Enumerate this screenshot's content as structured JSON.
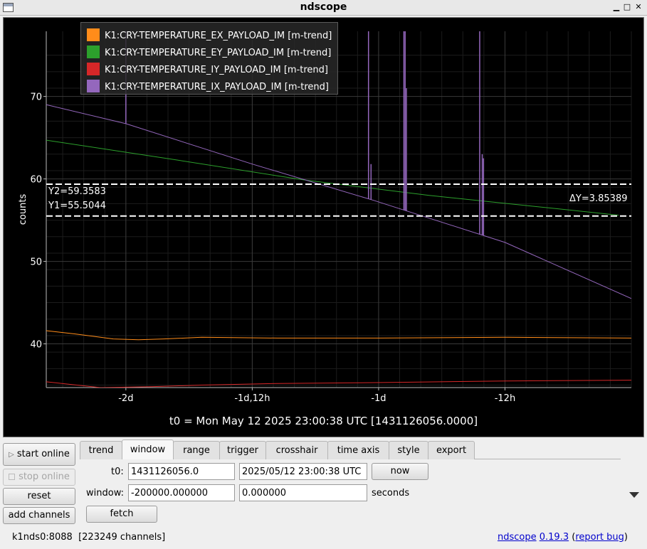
{
  "window": {
    "title": "ndscope",
    "minimize_glyph": "▁",
    "maximize_glyph": "□",
    "close_glyph": "✕"
  },
  "chart_data": {
    "type": "line",
    "xlabel": "",
    "ylabel": "counts",
    "x_unit": "days relative to t0",
    "xlim": [
      -2.315,
      -0.0
    ],
    "ylim": [
      34.7,
      77.9
    ],
    "x_ticks": [
      {
        "value": -2.0,
        "label": "-2d"
      },
      {
        "value": -1.5,
        "label": "-1d,12h"
      },
      {
        "value": -1.0,
        "label": "-1d"
      },
      {
        "value": -0.5,
        "label": "-12h"
      }
    ],
    "y_ticks": [
      40,
      50,
      60,
      70
    ],
    "grid": true,
    "legend_placement": "top-left",
    "series": [
      {
        "name": "K1:CRY-TEMPERATURE_EX_PAYLOAD_IM [m-trend]",
        "color": "#ff8c1a",
        "points": [
          [
            -2.315,
            41.6
          ],
          [
            -2.2,
            41.2
          ],
          [
            -2.05,
            40.6
          ],
          [
            -1.95,
            40.5
          ],
          [
            -1.85,
            40.6
          ],
          [
            -1.7,
            40.8
          ],
          [
            -1.4,
            40.7
          ],
          [
            -1.0,
            40.7
          ],
          [
            -0.5,
            40.8
          ],
          [
            0.0,
            40.7
          ]
        ]
      },
      {
        "name": "K1:CRY-TEMPERATURE_EY_PAYLOAD_IM [m-trend]",
        "color": "#2ca02c",
        "points": [
          [
            -2.315,
            64.7
          ],
          [
            -1.8,
            62.3
          ],
          [
            -1.3,
            59.9
          ],
          [
            -0.8,
            58.0
          ],
          [
            -0.3,
            56.4
          ],
          [
            -0.05,
            55.6
          ]
        ]
      },
      {
        "name": "K1:CRY-TEMPERATURE_IY_PAYLOAD_IM [m-trend]",
        "color": "#d62728",
        "points": [
          [
            -2.315,
            35.4
          ],
          [
            -2.1,
            34.7
          ],
          [
            -1.9,
            34.8
          ],
          [
            -1.7,
            35.0
          ],
          [
            -1.4,
            35.2
          ],
          [
            -1.0,
            35.3
          ],
          [
            -0.5,
            35.5
          ],
          [
            0.0,
            35.6
          ]
        ]
      },
      {
        "name": "K1:CRY-TEMPERATURE_IX_PAYLOAD_IM [m-trend]",
        "color": "#9467bd",
        "points": [
          [
            -2.315,
            69.0
          ],
          [
            -2.0,
            66.7
          ],
          [
            -1.5,
            61.8
          ],
          [
            -1.02,
            57.4
          ],
          [
            -0.5,
            52.3
          ],
          [
            0.0,
            45.5
          ]
        ],
        "spikes": [
          {
            "x": -2.0,
            "y": 77.9
          },
          {
            "x": -1.04,
            "y": 77.9
          },
          {
            "x": -1.03,
            "y": 61.8
          },
          {
            "x": -0.9,
            "y": 77.9
          },
          {
            "x": -0.895,
            "y": 77.9
          },
          {
            "x": -0.89,
            "y": 71.0
          },
          {
            "x": -0.6,
            "y": 77.9
          },
          {
            "x": -0.59,
            "y": 63.0
          },
          {
            "x": -0.585,
            "y": 62.5
          }
        ]
      }
    ],
    "cursors": {
      "y1": {
        "value": 55.5044,
        "label": "Y1=55.5044"
      },
      "y2": {
        "value": 59.3583,
        "label": "Y2=59.3583"
      },
      "delta_label": "ΔY=3.85389"
    }
  },
  "t0_label": "t0 = Mon May 12 2025 23:00:38 UTC [1431126056.0000]",
  "controls": {
    "start_online": "start online",
    "stop_online": "stop online",
    "reset": "reset",
    "add_channels": "add channels"
  },
  "tabs": [
    {
      "label": "trend"
    },
    {
      "label": "window"
    },
    {
      "label": "range"
    },
    {
      "label": "trigger"
    },
    {
      "label": "crosshair"
    },
    {
      "label": "time axis"
    },
    {
      "label": "style"
    },
    {
      "label": "export"
    }
  ],
  "active_tab": "window",
  "window_tab": {
    "t0_label": "t0:",
    "t0_gps": "1431126056.0",
    "t0_utc": "2025/05/12 23:00:38 UTC",
    "now_button": "now",
    "window_label": "window:",
    "window_start": "-200000.000000",
    "window_end": "0.000000",
    "seconds_label": "seconds",
    "fetch_button": "fetch"
  },
  "status": {
    "server": "k1nds0:8088",
    "channels": "[223249 channels]",
    "app_link": "ndscope",
    "version_link": "0.19.3",
    "open_paren": " (",
    "report_link": "report bug",
    "close_paren": ")"
  }
}
